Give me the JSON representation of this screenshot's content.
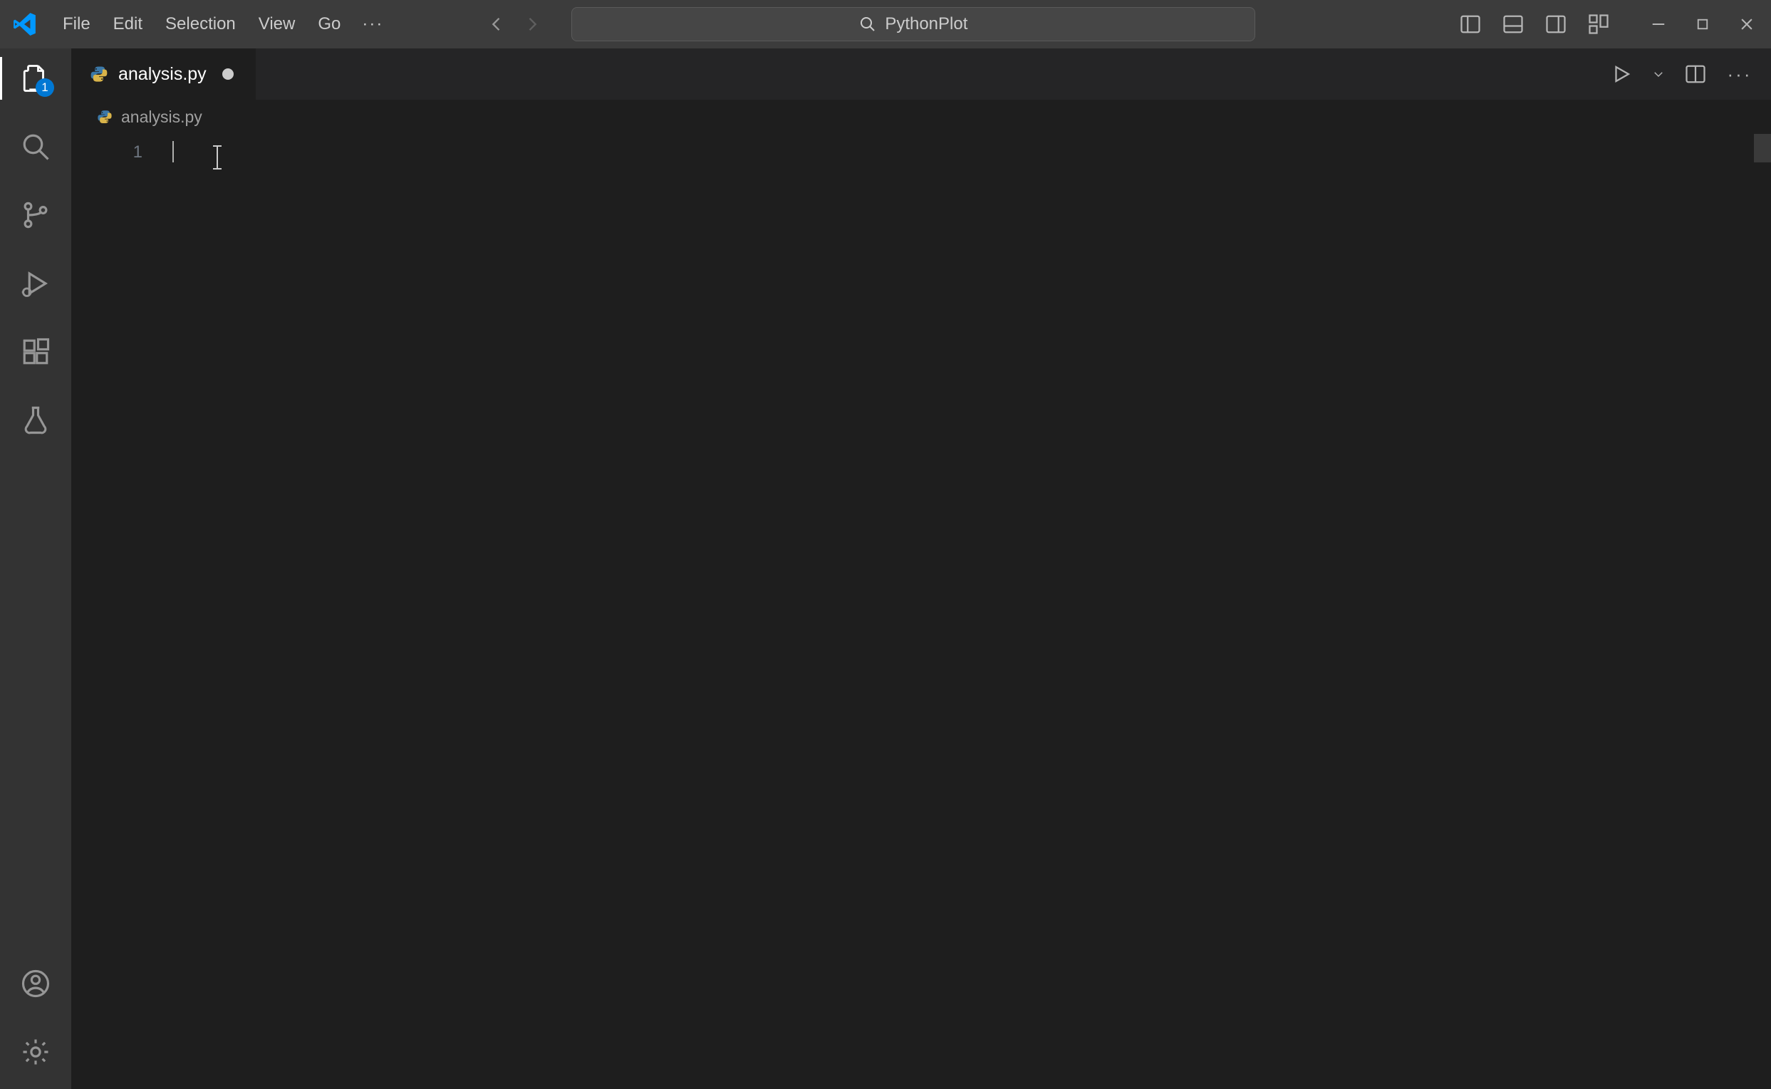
{
  "menu": {
    "file": "File",
    "edit": "Edit",
    "selection": "Selection",
    "view": "View",
    "go": "Go",
    "more": "···"
  },
  "command_center": {
    "text": "PythonPlot"
  },
  "activitybar": {
    "explorer_badge": "1"
  },
  "tab": {
    "filename": "analysis.py"
  },
  "breadcrumb": {
    "filename": "analysis.py"
  },
  "editor": {
    "line_number_1": "1",
    "content": ""
  }
}
